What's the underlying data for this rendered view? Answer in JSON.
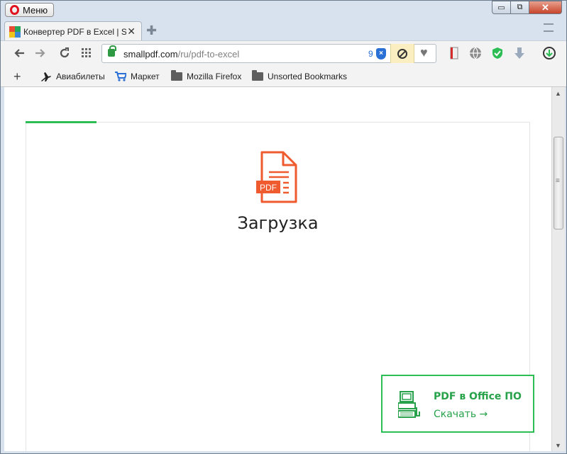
{
  "browser": {
    "menu_label": "Меню",
    "window_controls": {
      "minimize": "▭",
      "maximize": "⧉",
      "close": "✕"
    }
  },
  "tab": {
    "title": "Конвертер PDF в Excel | Sr",
    "close": "✕",
    "new_tab": "✚"
  },
  "address": {
    "domain": "smallpdf.com",
    "path": "/ru/pdf-to-excel",
    "badge_count": "9"
  },
  "bookmarks": [
    {
      "label": "Авиабилеты",
      "icon": "airplane-icon"
    },
    {
      "label": "Маркет",
      "icon": "cart-icon"
    },
    {
      "label": "Mozilla Firefox",
      "icon": "folder-icon"
    },
    {
      "label": "Unsorted Bookmarks",
      "icon": "folder-icon"
    }
  ],
  "bookmarks_add": "+",
  "page": {
    "file_badge": "PDF",
    "status": "Загрузка",
    "upload_progress": 0.14,
    "promo": {
      "title": "PDF в Office ПО",
      "link": "Скачать →"
    }
  },
  "colors": {
    "accent_green": "#2cbd55",
    "pdf_orange": "#ef5a2f"
  }
}
